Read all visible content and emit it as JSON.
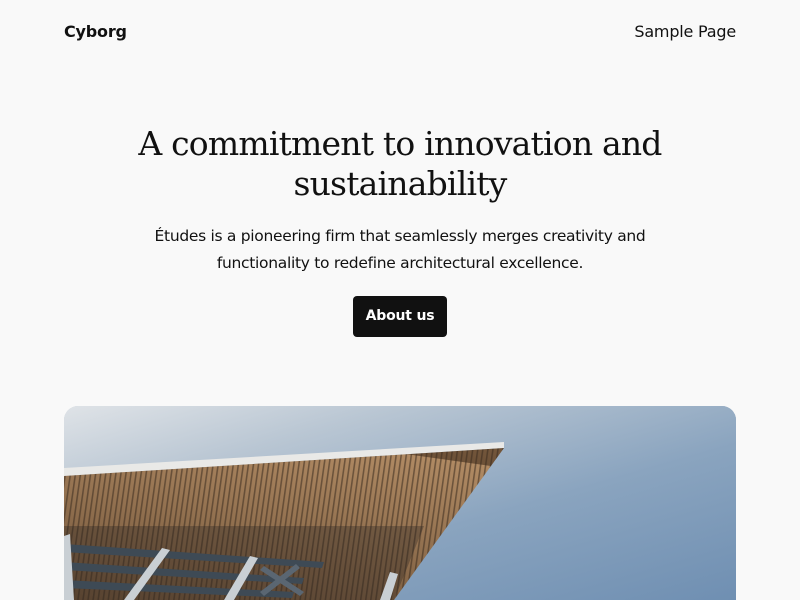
{
  "header": {
    "site_title": "Cyborg",
    "nav": [
      {
        "label": "Sample Page"
      }
    ]
  },
  "hero": {
    "title": "A commitment to innovation and sustainability",
    "description": "Études is a pioneering firm that seamlessly merges creativity and functionality to redefine architectural excellence.",
    "button_label": "About us"
  },
  "colors": {
    "background": "#f9f9f9",
    "text": "#111111",
    "button_bg": "#111111",
    "button_text": "#ffffff"
  }
}
